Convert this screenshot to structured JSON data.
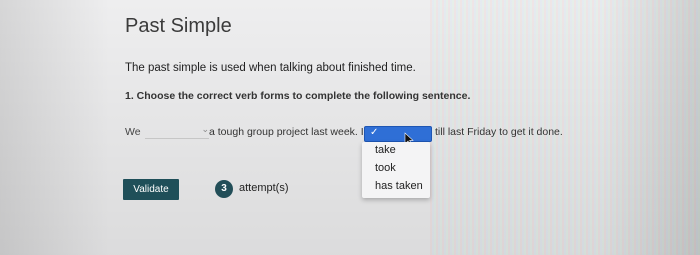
{
  "title": "Past Simple",
  "intro": "The past simple is used when talking about finished time.",
  "instruction": "1. Choose the correct verb forms to complete the following sentence.",
  "sentence": {
    "start": "We",
    "select1_value": "",
    "middle": "a tough group project last week. I",
    "select2_value": "✓",
    "end": "till last Friday to get it done."
  },
  "dropdown": {
    "options": [
      "take",
      "took",
      "has taken"
    ]
  },
  "validate_label": "Validate",
  "attempts": {
    "count": "3",
    "label": "attempt(s)"
  },
  "colors": {
    "button_bg": "#1f4f59",
    "select_active": "#2f6fd6",
    "badge_bg": "#224e58"
  },
  "icons": {
    "select1_chevron": "chevron-down-icon",
    "select2_check": "check-icon",
    "cursor": "mouse-pointer-icon"
  }
}
